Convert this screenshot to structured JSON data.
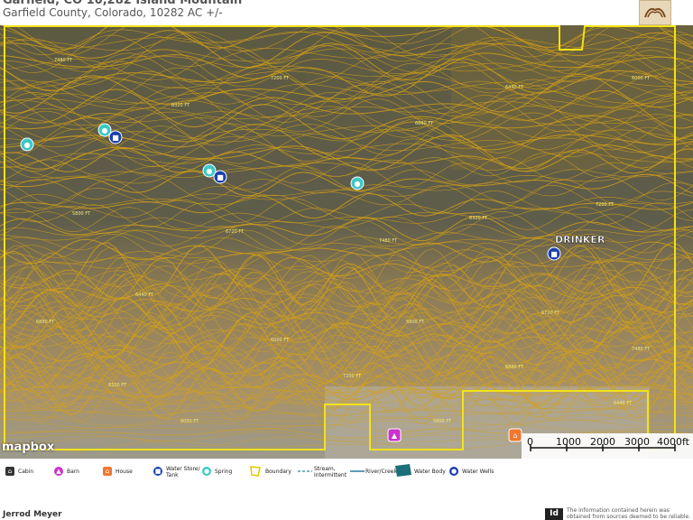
{
  "header": {
    "title": "Garfield, CO 10,282 Island Mountain",
    "subtitle": "Garfield County, Colorado, 10282 AC +/-"
  },
  "map": {
    "attribution": "mapbox",
    "place_labels": [
      {
        "name": "DRINKER"
      }
    ],
    "contour_labels": [
      "7480 FT",
      "8320 FT",
      "7200 FT",
      "6880 FT",
      "6440 FT",
      "6000 FT",
      "5800 FT",
      "6720 FT"
    ],
    "scale": {
      "ticks": [
        "0",
        "1000",
        "2000",
        "3000",
        "4000ft"
      ]
    },
    "colors": {
      "boundary": "#f2e318",
      "contour": "#d4a017",
      "spring": "#3cc8c8",
      "water_store": "#1a3fb0",
      "barn": "#cc33cc",
      "house": "#f07830"
    }
  },
  "legend": {
    "items": [
      {
        "label": "Cabin",
        "icon": "cabin-icon"
      },
      {
        "label": "Barn",
        "icon": "barn-icon"
      },
      {
        "label": "House",
        "icon": "house-icon"
      },
      {
        "label": "Water Store/ Tank",
        "icon": "water-tank-icon"
      },
      {
        "label": "Spring",
        "icon": "spring-icon"
      },
      {
        "label": "Boundary",
        "icon": "boundary-icon"
      },
      {
        "label": "Stream, Intermittent",
        "icon": "stream-intermittent-icon"
      },
      {
        "label": "River/Creek",
        "icon": "river-icon"
      },
      {
        "label": "Water Body",
        "icon": "water-body-icon"
      },
      {
        "label": "Water Wells",
        "icon": "water-well-icon"
      }
    ]
  },
  "footer": {
    "agent_name": "Jerrod Meyer",
    "disclaimer": "The information contained herein was obtained from sources deemed to be reliable.",
    "logo_text": "Id"
  }
}
